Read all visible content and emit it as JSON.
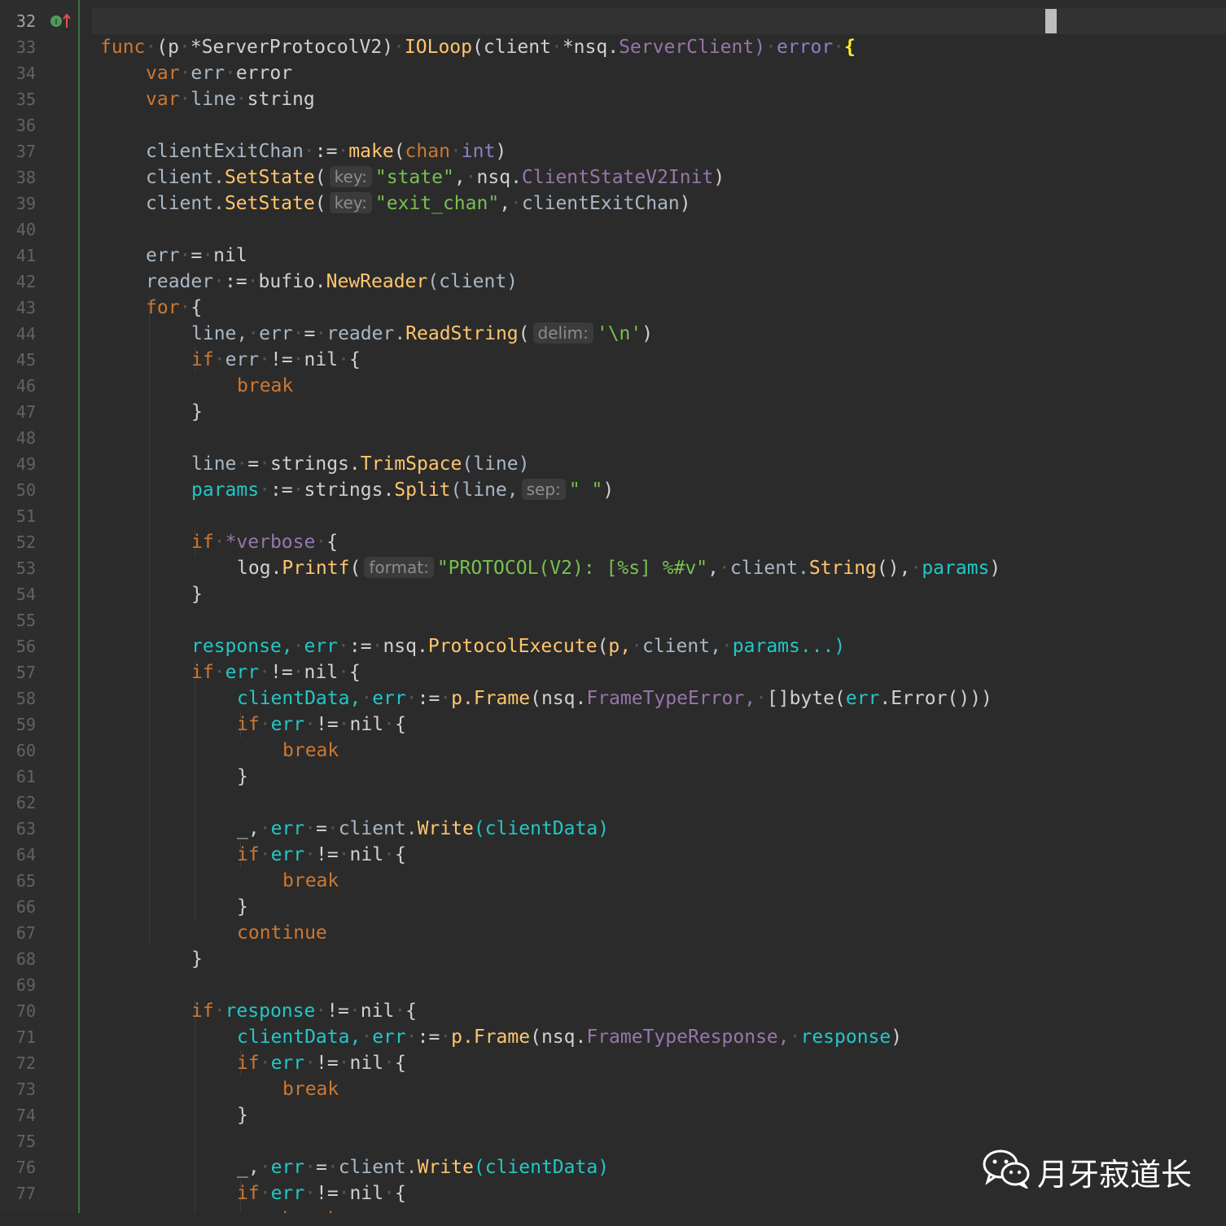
{
  "editor": {
    "current_line": "32",
    "line_numbers": [
      "32",
      "33",
      "34",
      "35",
      "36",
      "37",
      "38",
      "39",
      "40",
      "41",
      "42",
      "43",
      "44",
      "45",
      "46",
      "47",
      "48",
      "49",
      "50",
      "51",
      "52",
      "53",
      "54",
      "55",
      "56",
      "57",
      "58",
      "59",
      "60",
      "61",
      "62",
      "63",
      "64",
      "65",
      "66",
      "67",
      "68",
      "69",
      "70",
      "71",
      "72",
      "73",
      "74",
      "75",
      "76",
      "77"
    ]
  },
  "code": {
    "l32": {
      "a": "func",
      "b": "(p",
      "c": "*ServerProtocolV2)",
      "d": "IOLoop",
      "e": "(client",
      "f": "*nsq.",
      "g": "ServerClient)",
      "h": "error",
      "i": "{"
    },
    "l33": {
      "a": "var",
      "b": "err",
      "c": "error"
    },
    "l34": {
      "a": "var",
      "b": "line",
      "c": "string"
    },
    "l36": {
      "a": "clientExitChan",
      "b": ":=",
      "c": "make",
      "d": "(",
      "e": "chan",
      "f": "int",
      "g": ")"
    },
    "l37": {
      "a": "client.",
      "b": "SetState",
      "c": "(",
      "hint": "key:",
      "d": "\"state\"",
      "e": ",",
      "f": "nsq.",
      "g": "ClientStateV2Init",
      "h": ")"
    },
    "l38": {
      "a": "client.",
      "b": "SetState",
      "c": "(",
      "hint": "key:",
      "d": "\"exit_chan\"",
      "e": ",",
      "f": "clientExitChan",
      "g": ")"
    },
    "l40": {
      "a": "err",
      "b": "=",
      "c": "nil"
    },
    "l41": {
      "a": "reader",
      "b": ":=",
      "c": "bufio.",
      "d": "NewReader",
      "e": "(client)"
    },
    "l42": {
      "a": "for",
      "b": "{"
    },
    "l43": {
      "a": "line,",
      "b": "err",
      "c": "=",
      "d": "reader.",
      "e": "ReadString",
      "f": "(",
      "hint": "delim:",
      "g": "'\\n'",
      "h": ")"
    },
    "l44": {
      "a": "if",
      "b": "err",
      "c": "!=",
      "d": "nil",
      "e": "{"
    },
    "l45": {
      "a": "break"
    },
    "l46": {
      "a": "}"
    },
    "l48": {
      "a": "line",
      "b": "=",
      "c": "strings.",
      "d": "TrimSpace",
      "e": "(line)"
    },
    "l49": {
      "a": "params",
      "b": ":=",
      "c": "strings.",
      "d": "Split",
      "e": "(line,",
      "hint": "sep:",
      "f": "\" \"",
      "g": ")"
    },
    "l51": {
      "a": "if",
      "b": "*verbose",
      "c": "{"
    },
    "l52": {
      "a": "log.",
      "b": "Printf",
      "c": "(",
      "hint": "format:",
      "d": "\"PROTOCOL(V2): [%s] %#v\"",
      "e": ",",
      "f": "client.",
      "g": "String",
      "h": "(),",
      "i": "params",
      "j": ")"
    },
    "l53": {
      "a": "}"
    },
    "l55": {
      "a": "response,",
      "b": "err",
      "c": ":=",
      "d": "nsq.",
      "e": "ProtocolExecute",
      "f": "(",
      "g": "p,",
      "h": "client,",
      "i": "params...)"
    },
    "l56": {
      "a": "if",
      "b": "err",
      "c": "!=",
      "d": "nil",
      "e": "{"
    },
    "l57": {
      "a": "clientData,",
      "b": "err",
      "c": ":=",
      "d": "p.",
      "e": "Frame",
      "f": "(nsq.",
      "g": "FrameTypeError,",
      "h": "[]byte(",
      "i": "err",
      "j": ".Error()))"
    },
    "l58": {
      "a": "if",
      "b": "err",
      "c": "!=",
      "d": "nil",
      "e": "{"
    },
    "l59": {
      "a": "break"
    },
    "l60": {
      "a": "}"
    },
    "l62": {
      "a": "_,",
      "b": "err",
      "c": "=",
      "d": "client.",
      "e": "Write",
      "f": "(clientData)"
    },
    "l63": {
      "a": "if",
      "b": "err",
      "c": "!=",
      "d": "nil",
      "e": "{"
    },
    "l64": {
      "a": "break"
    },
    "l65": {
      "a": "}"
    },
    "l66": {
      "a": "continue"
    },
    "l67": {
      "a": "}"
    },
    "l69": {
      "a": "if",
      "b": "response",
      "c": "!=",
      "d": "nil",
      "e": "{"
    },
    "l70": {
      "a": "clientData,",
      "b": "err",
      "c": ":=",
      "d": "p.",
      "e": "Frame",
      "f": "(nsq.",
      "g": "FrameTypeResponse,",
      "h": "response",
      "i": ")"
    },
    "l71": {
      "a": "if",
      "b": "err",
      "c": "!=",
      "d": "nil",
      "e": "{"
    },
    "l72": {
      "a": "break"
    },
    "l73": {
      "a": "}"
    },
    "l75": {
      "a": "_,",
      "b": "err",
      "c": "=",
      "d": "client.",
      "e": "Write",
      "f": "(clientData)"
    },
    "l76": {
      "a": "if",
      "b": "err",
      "c": "!=",
      "d": "nil",
      "e": "{"
    },
    "l77": {
      "a": "break"
    }
  },
  "watermark": {
    "text": "月牙寂道长",
    "icon": "wechat-icon"
  },
  "colors": {
    "background": "#2b2b2b",
    "keyword": "#cc7832",
    "function": "#ffc66d",
    "string": "#6a8759",
    "field": "#9876aa",
    "identifier": "#22c7c7"
  }
}
